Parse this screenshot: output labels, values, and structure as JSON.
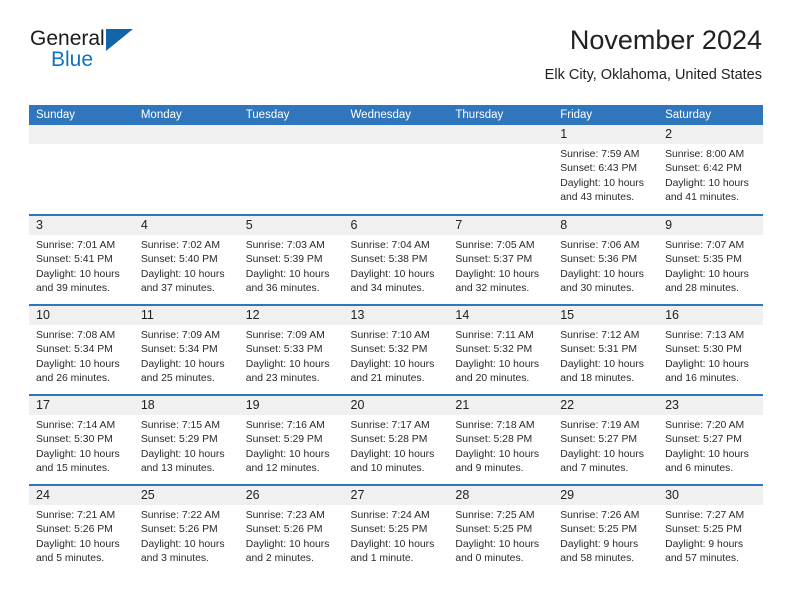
{
  "logo": {
    "word_one": "General",
    "word_two": "Blue",
    "triangle_color": "#1464aa",
    "blue_text_color": "#1273c4"
  },
  "header": {
    "month_title": "November 2024",
    "location": "Elk City, Oklahoma, United States"
  },
  "theme": {
    "header_blue": "#3076bd",
    "daynum_background": "#f0f0f0",
    "text_color": "#222222"
  },
  "calendar": {
    "weekday_headers": [
      "Sunday",
      "Monday",
      "Tuesday",
      "Wednesday",
      "Thursday",
      "Friday",
      "Saturday"
    ],
    "labels": {
      "sunrise": "Sunrise:",
      "sunset": "Sunset:",
      "daylight": "Daylight:"
    },
    "weeks": [
      [
        {
          "day": "",
          "empty": true
        },
        {
          "day": "",
          "empty": true
        },
        {
          "day": "",
          "empty": true
        },
        {
          "day": "",
          "empty": true
        },
        {
          "day": "",
          "empty": true
        },
        {
          "day": "1",
          "sunrise": "Sunrise: 7:59 AM",
          "sunset": "Sunset: 6:43 PM",
          "daylight": "Daylight: 10 hours and 43 minutes."
        },
        {
          "day": "2",
          "sunrise": "Sunrise: 8:00 AM",
          "sunset": "Sunset: 6:42 PM",
          "daylight": "Daylight: 10 hours and 41 minutes."
        }
      ],
      [
        {
          "day": "3",
          "sunrise": "Sunrise: 7:01 AM",
          "sunset": "Sunset: 5:41 PM",
          "daylight": "Daylight: 10 hours and 39 minutes."
        },
        {
          "day": "4",
          "sunrise": "Sunrise: 7:02 AM",
          "sunset": "Sunset: 5:40 PM",
          "daylight": "Daylight: 10 hours and 37 minutes."
        },
        {
          "day": "5",
          "sunrise": "Sunrise: 7:03 AM",
          "sunset": "Sunset: 5:39 PM",
          "daylight": "Daylight: 10 hours and 36 minutes."
        },
        {
          "day": "6",
          "sunrise": "Sunrise: 7:04 AM",
          "sunset": "Sunset: 5:38 PM",
          "daylight": "Daylight: 10 hours and 34 minutes."
        },
        {
          "day": "7",
          "sunrise": "Sunrise: 7:05 AM",
          "sunset": "Sunset: 5:37 PM",
          "daylight": "Daylight: 10 hours and 32 minutes."
        },
        {
          "day": "8",
          "sunrise": "Sunrise: 7:06 AM",
          "sunset": "Sunset: 5:36 PM",
          "daylight": "Daylight: 10 hours and 30 minutes."
        },
        {
          "day": "9",
          "sunrise": "Sunrise: 7:07 AM",
          "sunset": "Sunset: 5:35 PM",
          "daylight": "Daylight: 10 hours and 28 minutes."
        }
      ],
      [
        {
          "day": "10",
          "sunrise": "Sunrise: 7:08 AM",
          "sunset": "Sunset: 5:34 PM",
          "daylight": "Daylight: 10 hours and 26 minutes."
        },
        {
          "day": "11",
          "sunrise": "Sunrise: 7:09 AM",
          "sunset": "Sunset: 5:34 PM",
          "daylight": "Daylight: 10 hours and 25 minutes."
        },
        {
          "day": "12",
          "sunrise": "Sunrise: 7:09 AM",
          "sunset": "Sunset: 5:33 PM",
          "daylight": "Daylight: 10 hours and 23 minutes."
        },
        {
          "day": "13",
          "sunrise": "Sunrise: 7:10 AM",
          "sunset": "Sunset: 5:32 PM",
          "daylight": "Daylight: 10 hours and 21 minutes."
        },
        {
          "day": "14",
          "sunrise": "Sunrise: 7:11 AM",
          "sunset": "Sunset: 5:32 PM",
          "daylight": "Daylight: 10 hours and 20 minutes."
        },
        {
          "day": "15",
          "sunrise": "Sunrise: 7:12 AM",
          "sunset": "Sunset: 5:31 PM",
          "daylight": "Daylight: 10 hours and 18 minutes."
        },
        {
          "day": "16",
          "sunrise": "Sunrise: 7:13 AM",
          "sunset": "Sunset: 5:30 PM",
          "daylight": "Daylight: 10 hours and 16 minutes."
        }
      ],
      [
        {
          "day": "17",
          "sunrise": "Sunrise: 7:14 AM",
          "sunset": "Sunset: 5:30 PM",
          "daylight": "Daylight: 10 hours and 15 minutes."
        },
        {
          "day": "18",
          "sunrise": "Sunrise: 7:15 AM",
          "sunset": "Sunset: 5:29 PM",
          "daylight": "Daylight: 10 hours and 13 minutes."
        },
        {
          "day": "19",
          "sunrise": "Sunrise: 7:16 AM",
          "sunset": "Sunset: 5:29 PM",
          "daylight": "Daylight: 10 hours and 12 minutes."
        },
        {
          "day": "20",
          "sunrise": "Sunrise: 7:17 AM",
          "sunset": "Sunset: 5:28 PM",
          "daylight": "Daylight: 10 hours and 10 minutes."
        },
        {
          "day": "21",
          "sunrise": "Sunrise: 7:18 AM",
          "sunset": "Sunset: 5:28 PM",
          "daylight": "Daylight: 10 hours and 9 minutes."
        },
        {
          "day": "22",
          "sunrise": "Sunrise: 7:19 AM",
          "sunset": "Sunset: 5:27 PM",
          "daylight": "Daylight: 10 hours and 7 minutes."
        },
        {
          "day": "23",
          "sunrise": "Sunrise: 7:20 AM",
          "sunset": "Sunset: 5:27 PM",
          "daylight": "Daylight: 10 hours and 6 minutes."
        }
      ],
      [
        {
          "day": "24",
          "sunrise": "Sunrise: 7:21 AM",
          "sunset": "Sunset: 5:26 PM",
          "daylight": "Daylight: 10 hours and 5 minutes."
        },
        {
          "day": "25",
          "sunrise": "Sunrise: 7:22 AM",
          "sunset": "Sunset: 5:26 PM",
          "daylight": "Daylight: 10 hours and 3 minutes."
        },
        {
          "day": "26",
          "sunrise": "Sunrise: 7:23 AM",
          "sunset": "Sunset: 5:26 PM",
          "daylight": "Daylight: 10 hours and 2 minutes."
        },
        {
          "day": "27",
          "sunrise": "Sunrise: 7:24 AM",
          "sunset": "Sunset: 5:25 PM",
          "daylight": "Daylight: 10 hours and 1 minute."
        },
        {
          "day": "28",
          "sunrise": "Sunrise: 7:25 AM",
          "sunset": "Sunset: 5:25 PM",
          "daylight": "Daylight: 10 hours and 0 minutes."
        },
        {
          "day": "29",
          "sunrise": "Sunrise: 7:26 AM",
          "sunset": "Sunset: 5:25 PM",
          "daylight": "Daylight: 9 hours and 58 minutes."
        },
        {
          "day": "30",
          "sunrise": "Sunrise: 7:27 AM",
          "sunset": "Sunset: 5:25 PM",
          "daylight": "Daylight: 9 hours and 57 minutes."
        }
      ]
    ]
  }
}
